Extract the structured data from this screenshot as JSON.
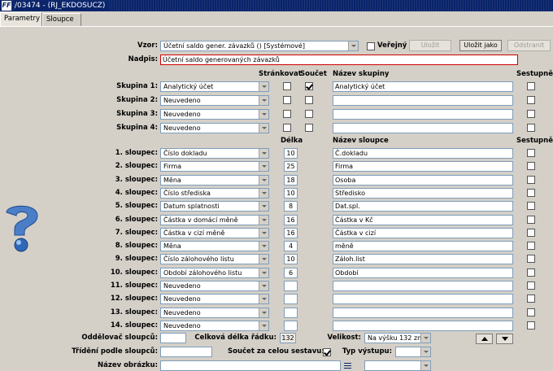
{
  "window": {
    "title": "/03474 - (RJ_EKDOSUCZ)",
    "logo": "FF"
  },
  "tabs": [
    {
      "label": "Parametry"
    },
    {
      "label": "Sloupce"
    }
  ],
  "top": {
    "vzor_label": "Vzor:",
    "vzor_value": "Účetní saldo gener. závazků   ()  [Systémové]",
    "verejny_label": "Veřejný",
    "verejny_checked": false,
    "ulozit": "Uložit",
    "ulozit_jako": "Uložit jako",
    "odstranit": "Odstranit",
    "nadpis_label": "Nadpis:",
    "nadpis_value": "Účetní saldo generovaných závazků"
  },
  "groups_header": {
    "strankovat": "Stránkovat",
    "soucet": "Součet",
    "nazev_skupiny": "Název skupiny",
    "sestupne": "Sestupně"
  },
  "groups": [
    {
      "label": "Skupina 1:",
      "value": "Analytický účet",
      "strankovat": false,
      "soucet": true,
      "name": "Analytický účet",
      "sestupne": false
    },
    {
      "label": "Skupina 2:",
      "value": "Neuvedeno",
      "strankovat": false,
      "soucet": false,
      "name": "",
      "sestupne": false
    },
    {
      "label": "Skupina 3:",
      "value": "Neuvedeno",
      "strankovat": false,
      "soucet": false,
      "name": "",
      "sestupne": false
    },
    {
      "label": "Skupina 4:",
      "value": "Neuvedeno",
      "strankovat": false,
      "soucet": false,
      "name": "",
      "sestupne": false
    }
  ],
  "columns_header": {
    "delka": "Délka",
    "nazev_sloupce": "Název sloupce",
    "sestupne": "Sestupně"
  },
  "columns": [
    {
      "label": "1. sloupec:",
      "value": "Číslo dokladu",
      "delka": "10",
      "name": "Č.dokladu"
    },
    {
      "label": "2. sloupec:",
      "value": "Firma",
      "delka": "25",
      "name": "Firma"
    },
    {
      "label": "3. sloupec:",
      "value": "Měna",
      "delka": "18",
      "name": "Osoba"
    },
    {
      "label": "4. sloupec:",
      "value": "Číslo střediska",
      "delka": "10",
      "name": "Středisko"
    },
    {
      "label": "5. sloupec:",
      "value": "Datum splatnosti",
      "delka": "8",
      "name": "Dat.spl."
    },
    {
      "label": "6. sloupec:",
      "value": "Částka v domácí měně",
      "delka": "16",
      "name": "Částka v Kč"
    },
    {
      "label": "7. sloupec:",
      "value": "Částka v cizí měně",
      "delka": "16",
      "name": "Částka v cizí"
    },
    {
      "label": "8. sloupec:",
      "value": "Měna",
      "delka": "4",
      "name": "měně"
    },
    {
      "label": "9. sloupec:",
      "value": "Číslo zálohového listu",
      "delka": "10",
      "name": "Záloh.list"
    },
    {
      "label": "10. sloupec:",
      "value": "Období zálohového listu",
      "delka": "6",
      "name": "Období"
    },
    {
      "label": "11. sloupec:",
      "value": "Neuvedeno",
      "delka": "",
      "name": ""
    },
    {
      "label": "12. sloupec:",
      "value": "Neuvedeno",
      "delka": "",
      "name": ""
    },
    {
      "label": "13. sloupec:",
      "value": "Neuvedeno",
      "delka": "",
      "name": ""
    },
    {
      "label": "14. sloupec:",
      "value": "Neuvedeno",
      "delka": "",
      "name": ""
    }
  ],
  "bottom": {
    "oddelovac_label": "Oddělovač sloupců:",
    "oddelovac_value": "",
    "celkova_label": "Celková délka řádku:",
    "celkova_value": "132",
    "velikost_label": "Velikost:",
    "velikost_value": "Na výšku 132 zn.",
    "trideni_label": "Třídění podle sloupců:",
    "trideni_value": "",
    "soucet_label": "Součet za celou sestavu:",
    "soucet_checked": true,
    "typ_label": "Typ výstupu:",
    "typ_value": "",
    "obrazek_label": "Název obrázku:",
    "obrazek_value": "",
    "obrazek_combo": ""
  },
  "icons": {
    "help": "help-question-icon",
    "list": "list-icon"
  }
}
